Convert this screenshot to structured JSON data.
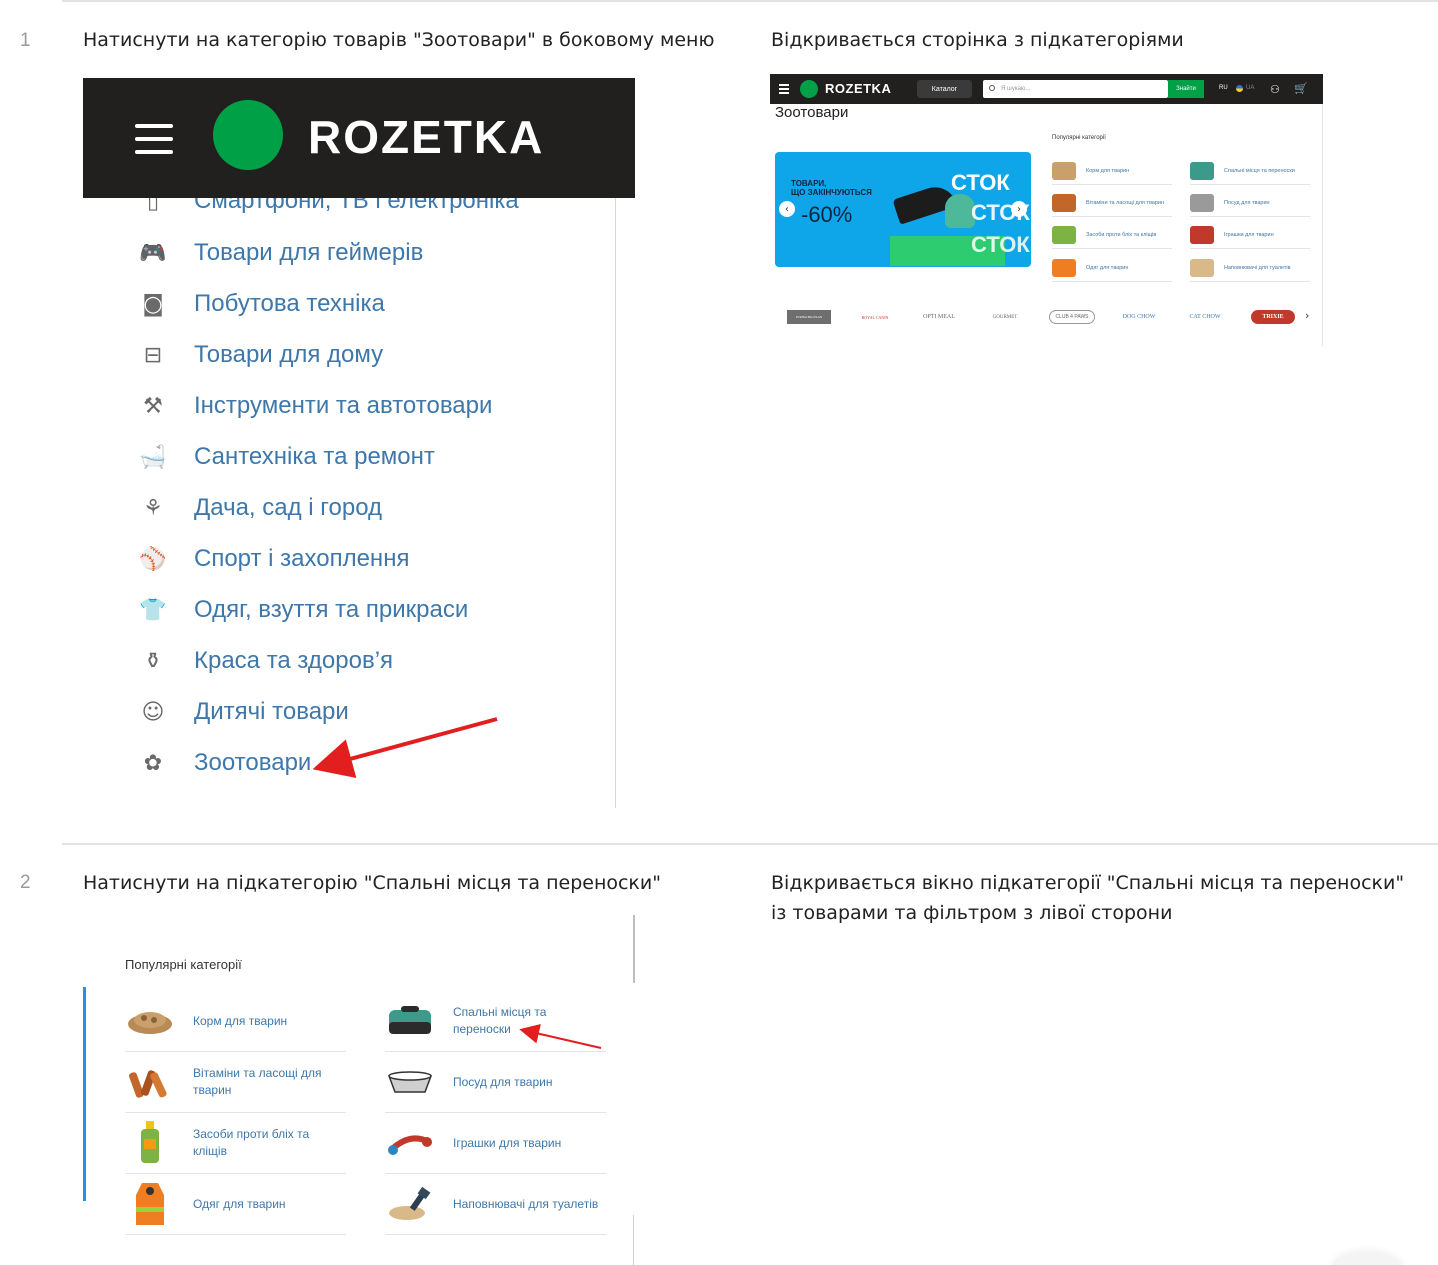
{
  "steps": [
    {
      "number": "1",
      "action": "Натиснути на категорію товарів \"Зоотовари\" в боковому меню",
      "result": "Відкривається сторінка з підкатегоріями"
    },
    {
      "number": "2",
      "action": "Натиснути на підкатегорію \"Спальні місця та переноски\"",
      "result": "Відкривається вікно підкатегорії \"Спальні місця та переноски\" із товарами та фільтром з лівої сторони"
    }
  ],
  "shot1": {
    "logo_text": "ROZETKA",
    "menu_items": [
      {
        "label": "Смартфони, ТВ і електроніка",
        "icon": "phone-icon"
      },
      {
        "label": "Товари для геймерів",
        "icon": "gamepad-icon"
      },
      {
        "label": "Побутова техніка",
        "icon": "washing-machine-icon"
      },
      {
        "label": "Товари для дому",
        "icon": "armchair-icon"
      },
      {
        "label": "Інструменти та автотовари",
        "icon": "drill-icon"
      },
      {
        "label": "Сантехніка та ремонт",
        "icon": "bathtub-icon"
      },
      {
        "label": "Дача, сад і город",
        "icon": "garden-tools-icon"
      },
      {
        "label": "Спорт і захоплення",
        "icon": "racket-icon"
      },
      {
        "label": "Одяг, взуття та прикраси",
        "icon": "tshirt-icon"
      },
      {
        "label": "Краса та здоров’я",
        "icon": "cosmetics-icon"
      },
      {
        "label": "Дитячі товари",
        "icon": "teddy-bear-icon"
      },
      {
        "label": "Зоотовари",
        "icon": "paw-icon"
      }
    ]
  },
  "shot2": {
    "logo_text": "ROZETKA",
    "catalog_label": "Каталог",
    "search_placeholder": "Я шукаю...",
    "search_button": "Знайти",
    "lang_ru": "RU",
    "lang_ua": "UA",
    "page_title": "Зоотовари",
    "popular_label": "Популярні категорії",
    "banner": {
      "line1": "ТОВАРИ,\nЩО ЗАКІНЧУЮТЬСЯ",
      "discount": "-60%",
      "stock_word": "СТОК",
      "colors": {
        "background": "#0ea5e9"
      }
    },
    "categories": [
      {
        "label": "Корм для тварин",
        "color": "#c9a06a"
      },
      {
        "label": "Спальні місця та переноски",
        "color": "#3c9a8a"
      },
      {
        "label": "Вітаміни та ласощі для тварин",
        "color": "#c2672b"
      },
      {
        "label": "Посуд для тварин",
        "color": "#9a9a9a"
      },
      {
        "label": "Засоби проти бліх та кліщів",
        "color": "#7cb342"
      },
      {
        "label": "Іграшки для тварин",
        "color": "#c0392b"
      },
      {
        "label": "Одяг для тварин",
        "color": "#ef7d22"
      },
      {
        "label": "Наповнювачі для туалетів",
        "color": "#d9b98a"
      }
    ],
    "brands": [
      "PURINA PRO PLAN",
      "ROYAL CANIN",
      "OPTI MEAL",
      "GOURMET",
      "CLUB 4 PAWS",
      "DOG CHOW",
      "CAT CHOW",
      "TRIXIE"
    ]
  },
  "shot3": {
    "popular_label": "Популярні категорії",
    "categories": [
      {
        "label": "Корм для тварин",
        "icon": "pet-food-icon"
      },
      {
        "label": "Спальні місця та переноски",
        "icon": "pet-carrier-icon"
      },
      {
        "label": "Вітаміни та ласощі для тварин",
        "icon": "treats-icon"
      },
      {
        "label": "Посуд для тварин",
        "icon": "pet-bowl-icon"
      },
      {
        "label": "Засоби проти бліх та кліщів",
        "icon": "flea-spray-icon"
      },
      {
        "label": "Іграшки для тварин",
        "icon": "rope-toy-icon"
      },
      {
        "label": "Одяг для тварин",
        "icon": "pet-vest-icon"
      },
      {
        "label": "Наповнювачі для туалетів",
        "icon": "litter-icon"
      }
    ]
  },
  "colors": {
    "accent_green": "#00a046",
    "header_dark": "#221f1f",
    "link_blue": "#3e77aa",
    "annotation_red": "#e11f1f"
  }
}
